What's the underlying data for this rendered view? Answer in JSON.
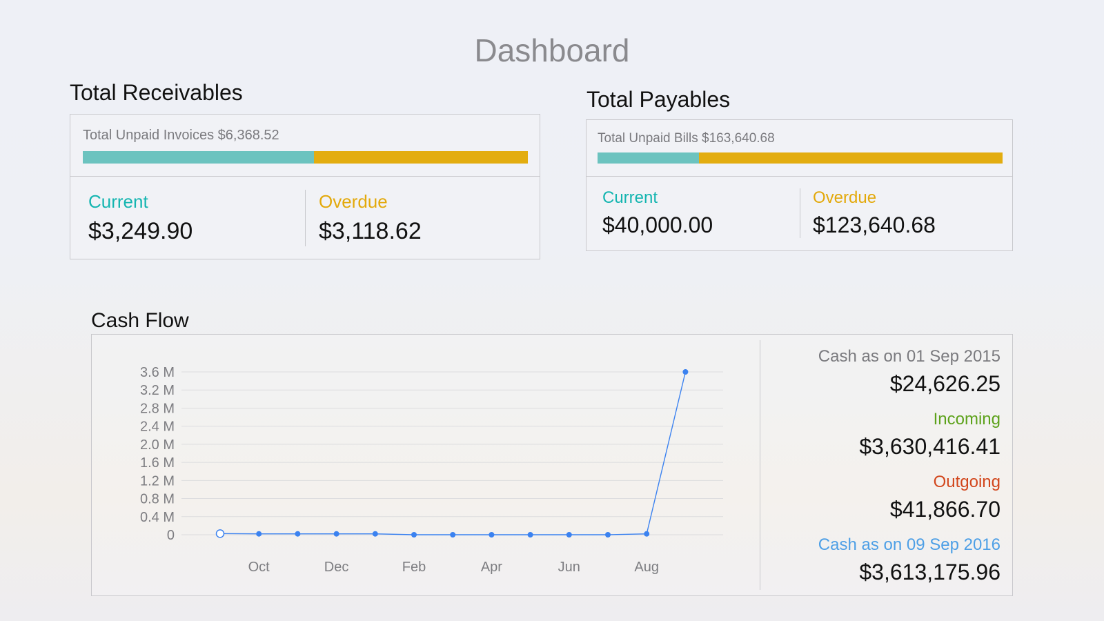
{
  "page": {
    "title": "Dashboard"
  },
  "receivables": {
    "title": "Total Receivables",
    "summary": "Total Unpaid Invoices $6,368.52",
    "current_label": "Current",
    "current_value": "$3,249.90",
    "overdue_label": "Overdue",
    "overdue_value": "$3,118.62",
    "current_fraction": 0.52
  },
  "payables": {
    "title": "Total Payables",
    "summary": "Total Unpaid Bills $163,640.68",
    "current_label": "Current",
    "current_value": "$40,000.00",
    "overdue_label": "Overdue",
    "overdue_value": "$123,640.68",
    "current_fraction": 0.25
  },
  "colors": {
    "current": "#14b5b0",
    "overdue": "#e3a90b",
    "bar_current": "#6cc3bf",
    "bar_overdue": "#e3ad10",
    "incoming": "#5ca21a",
    "outgoing": "#d2461c",
    "cash_end": "#4d9fe6",
    "line": "#3b82f0"
  },
  "cashflow": {
    "title": "Cash Flow",
    "cash_start_label": "Cash as on 01 Sep 2015",
    "cash_start_value": "$24,626.25",
    "incoming_label": "Incoming",
    "incoming_value": "$3,630,416.41",
    "outgoing_label": "Outgoing",
    "outgoing_value": "$41,866.70",
    "cash_end_label": "Cash as on 09 Sep 2016",
    "cash_end_value": "$3,613,175.96"
  },
  "chart_data": {
    "type": "line",
    "x_tick_labels": [
      "Oct",
      "Dec",
      "Feb",
      "Apr",
      "Jun",
      "Aug"
    ],
    "y_tick_labels": [
      "0",
      "0.4 M",
      "0.8 M",
      "1.2 M",
      "1.6 M",
      "2.0 M",
      "2.4 M",
      "2.8 M",
      "3.2 M",
      "3.6 M"
    ],
    "y_ticks": [
      0,
      0.4,
      0.8,
      1.2,
      1.6,
      2.0,
      2.4,
      2.8,
      3.2,
      3.6
    ],
    "ylim": [
      0,
      3.6
    ],
    "y_unit_millions": true,
    "grid": true,
    "points": [
      {
        "x": "Sep",
        "y": 0.025,
        "hollow": true
      },
      {
        "x": "Oct",
        "y": 0.02
      },
      {
        "x": "Nov",
        "y": 0.02
      },
      {
        "x": "Dec",
        "y": 0.02
      },
      {
        "x": "Jan",
        "y": 0.02
      },
      {
        "x": "Feb",
        "y": 0.0
      },
      {
        "x": "Mar",
        "y": 0.0
      },
      {
        "x": "Apr",
        "y": 0.0
      },
      {
        "x": "May",
        "y": 0.0
      },
      {
        "x": "Jun",
        "y": 0.0
      },
      {
        "x": "Jul",
        "y": 0.0
      },
      {
        "x": "Aug",
        "y": 0.02
      },
      {
        "x": "Sep",
        "y": 3.6
      }
    ]
  }
}
